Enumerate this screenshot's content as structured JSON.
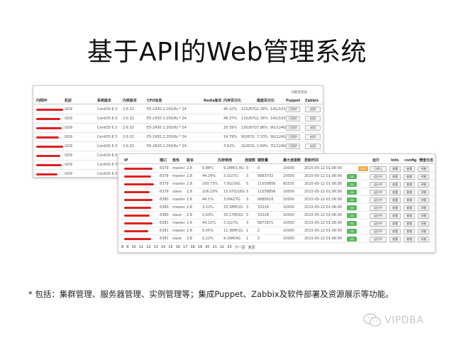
{
  "title": "基于API的Web管理系统",
  "back_panel": {
    "corner_label": "功能名状态",
    "headers": [
      "内网IP",
      "机房",
      "系统版本",
      "内核版本",
      "CPU信息",
      "Redis版本",
      "内存百分比",
      "磁盘百分比",
      "Puppet",
      "Zabbix"
    ],
    "rows": [
      {
        "room": "GD9",
        "os": "CentOS 6.3",
        "kernel": "2.6.32",
        "cpu": "E5-2430 2.20GHz * 24",
        "mem": "46.10%",
        "mem_total": "12G/87G",
        "disk": "1.36%",
        "disk_total": "14G/1037G",
        "puppet": "已同步",
        "zabbix": "启用"
      },
      {
        "room": "GD9",
        "os": "CentOS 6.3",
        "kernel": "2.6.32",
        "cpu": "E5-2430 2.20GHz * 24",
        "mem": "48.37%",
        "mem_total": "12G/87G",
        "disk": "1.36%",
        "disk_total": "14G/1037G",
        "puppet": "已同步",
        "zabbix": "启用"
      },
      {
        "room": "GD9",
        "os": "CentOS 6.3",
        "kernel": "2.6.32",
        "cpu": "E5-2430 2.20GHz * 24",
        "mem": "20.39%",
        "mem_total": "13G/87G",
        "disk": "7.86%",
        "disk_total": "9G/124G",
        "puppet": "已同步",
        "zabbix": "启用"
      },
      {
        "room": "GD9",
        "os": "CentOS 6.3",
        "kernel": "2.6.32",
        "cpu": "E5-2430 2.20GHz * 24",
        "mem": "14.79%",
        "mem_total": "9G/67G",
        "disk": "7.33%",
        "disk_total": "9G/124G",
        "puppet": "已同步",
        "zabbix": "启用"
      },
      {
        "room": "GD9",
        "os": "CentOS 6.3",
        "kernel": "2.6.32",
        "cpu": "E5-2630 2.20GHz * 24",
        "mem": "3.62%",
        "mem_total": "2G/67G",
        "disk": "1.69%",
        "disk_total": "7G/124G",
        "puppet": "已同步",
        "zabbix": "启用"
      },
      {
        "room": "GD9",
        "os": "CentOS 6.3",
        "kernel": "2.6.32"
      },
      {
        "room": "GD9",
        "os": "CentOS 6.3",
        "kernel": "2.6.32"
      },
      {
        "room": "GD9",
        "os": "CentOS 6.3"
      }
    ]
  },
  "front_panel": {
    "headers": [
      "IP",
      "端口",
      "角色",
      "版本",
      "内存使用",
      "连接数",
      "键数量",
      "最大连接数",
      "更新时间",
      "运行",
      "Info",
      "config",
      "慢查日志"
    ],
    "rows": [
      {
        "port": "6379",
        "role": "master",
        "ver": "2.8",
        "mem": "0.88%",
        "mem_total": "9.28M/1.8G",
        "conn": "0",
        "keys": "0",
        "max": "10000",
        "time": "2015-05-12 01:06:56",
        "status": "OFF",
        "status_type": "orange",
        "run": "已停止",
        "info": "查看",
        "slow": "详细"
      },
      {
        "port": "6379",
        "role": "master",
        "ver": "2.8",
        "mem": "44.24%",
        "mem_total": "3.1G/7G",
        "conn": "3",
        "keys": "6883702",
        "max": "10000",
        "time": "2015-05-12 01:06:56",
        "status": "ON",
        "status_type": "green",
        "run": "运行中",
        "info": "查看",
        "slow": "详细"
      },
      {
        "port": "6379",
        "role": "master",
        "ver": "2.8",
        "mem": "193.73%",
        "mem_total": "7.5G/16G",
        "conn": "5",
        "keys": "11039856",
        "max": "65535",
        "time": "2015-05-12 01:06:56",
        "status": "ON",
        "status_type": "green",
        "run": "运行中",
        "info": "查看",
        "slow": "详细"
      },
      {
        "port": "6379",
        "role": "slave",
        "ver": "2.8",
        "mem": "106.19%",
        "mem_total": "15.07G/16G",
        "conn": "5",
        "keys": "11039856",
        "max": "10000",
        "time": "2015-05-12 01:06:56",
        "status": "ON",
        "status_type": "green",
        "run": "运行中",
        "info": "查看",
        "slow": "详细"
      },
      {
        "port": "6380",
        "role": "master",
        "ver": "2.6",
        "mem": "44.1%",
        "mem_total": "3.09G/7G",
        "conn": "3",
        "keys": "6885618",
        "max": "10000",
        "time": "2015-05-12 01:06:56",
        "status": "ON",
        "status_type": "green",
        "run": "运行中",
        "info": "查看",
        "slow": "详细"
      },
      {
        "port": "6380",
        "role": "master",
        "ver": "2.8",
        "mem": "3.22%",
        "mem_total": "33.28M/1G",
        "conn": "3",
        "keys": "33226",
        "max": "10000",
        "time": "2015-05-12 01:06:56",
        "status": "ON",
        "status_type": "green",
        "run": "运行中",
        "info": "查看",
        "slow": "详细"
      },
      {
        "port": "6380",
        "role": "slave",
        "ver": "2.8",
        "mem": "1.63%",
        "mem_total": "33.17M/2G",
        "conn": "5",
        "keys": "33226",
        "max": "10000",
        "time": "2015-05-12 01:06:56",
        "status": "ON",
        "status_type": "green",
        "run": "运行中",
        "info": "查看",
        "slow": "详细"
      },
      {
        "port": "6381",
        "role": "master",
        "ver": "2.6",
        "mem": "44.22%",
        "mem_total": "3.1G/7G",
        "conn": "3",
        "keys": "6871671",
        "max": "10000",
        "time": "2015-05-12 01:06:56",
        "status": "ON",
        "status_type": "green",
        "run": "运行中",
        "info": "查看",
        "slow": "详细"
      },
      {
        "port": "6381",
        "role": "master",
        "ver": "2.8",
        "mem": "0.55%",
        "mem_total": "11.36M/1G",
        "conn": "1",
        "keys": "2",
        "max": "10000",
        "time": "2015-05-12 01:06:56",
        "status": "ON",
        "status_type": "green",
        "run": "运行中",
        "info": "查看",
        "slow": "详细"
      },
      {
        "port": "6381",
        "role": "slave",
        "ver": "2.8",
        "mem": "0.22%",
        "mem_total": "9.16M/4G",
        "conn": "1",
        "keys": "2",
        "max": "10000",
        "time": "2015-05-12 01:06:56",
        "status": "ON",
        "status_type": "green",
        "run": "运行中",
        "info": "查看",
        "slow": "详细"
      }
    ],
    "pager": [
      "8",
      "9",
      "10",
      "11",
      "12",
      "13",
      "14",
      "15",
      "16",
      "17",
      "18",
      "19",
      "20",
      "21",
      "22",
      "23",
      "下一页",
      "末页"
    ]
  },
  "footnote": "* 包括：集群管理、服务器管理、实例管理等；集成Puppet、Zabbix及软件部署及资源展示等功能。",
  "watermark": "VIPDBA",
  "colors": {
    "redaction": "#e02020",
    "on": "#5cb85c",
    "off": "#f0ad4e"
  }
}
